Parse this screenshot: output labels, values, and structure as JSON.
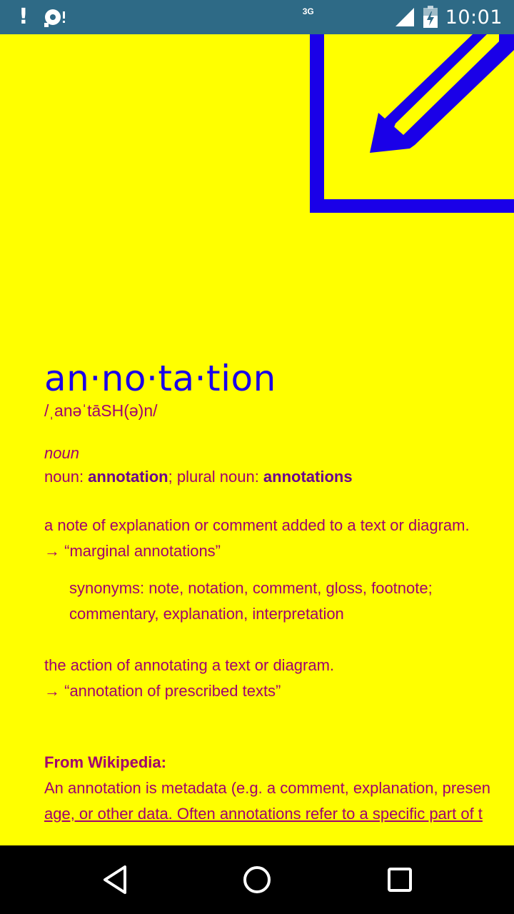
{
  "status_bar": {
    "network_type": "3G",
    "time": "10:01",
    "icons": [
      "alert-icon",
      "sync-icon",
      "signal-icon",
      "battery-icon"
    ]
  },
  "entry": {
    "headword": "an·no·ta·tion",
    "pronunciation": "/ˌanəˈtāSH(ə)n/",
    "part_of_speech": "noun",
    "forms": {
      "noun_label": "noun: ",
      "singular": "annotation",
      "separator": "; plural noun: ",
      "plural": "annotations"
    },
    "definitions": [
      {
        "text": "a note of explanation or comment added to a text or diagram.",
        "example": "→ “marginal annotations”",
        "synonyms_line1": "synonyms: note, notation, comment, gloss, footnote;",
        "synonyms_line2": "commentary, explanation, interpretation"
      },
      {
        "text": "the action of annotating a text or diagram.",
        "example": "→ “annotation of prescribed texts”"
      }
    ],
    "wikipedia": {
      "label": "From Wikipedia:",
      "line1": "An annotation is metadata (e.g. a comment, explanation, presen",
      "line2": "age, or other data. Often annotations refer to a specific part of t"
    }
  },
  "colors": {
    "background": "#ffff00",
    "headword": "#1a00e8",
    "text": "#a00070",
    "status_bar": "#2e6a86"
  },
  "nav_bar": {
    "icons": [
      "back-icon",
      "home-icon",
      "recents-icon"
    ]
  }
}
